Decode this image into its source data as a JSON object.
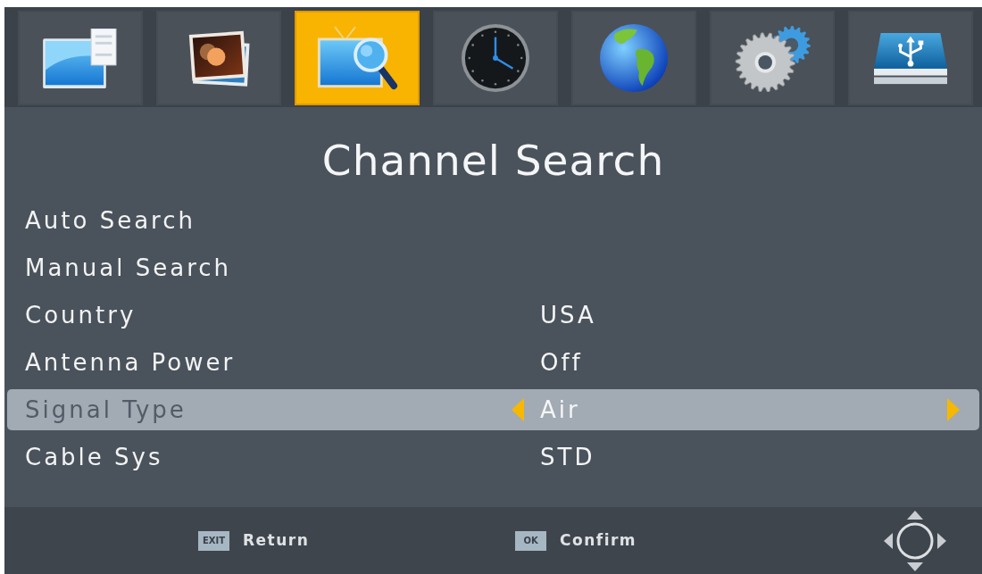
{
  "tabs": [
    {
      "kind": "document",
      "selected": false
    },
    {
      "kind": "photo",
      "selected": false
    },
    {
      "kind": "tv-search",
      "selected": true
    },
    {
      "kind": "clock",
      "selected": false
    },
    {
      "kind": "globe",
      "selected": false
    },
    {
      "kind": "gears",
      "selected": false
    },
    {
      "kind": "usb",
      "selected": false
    }
  ],
  "title": "Channel Search",
  "menu": [
    {
      "label": "Auto Search",
      "selected": false
    },
    {
      "label": "Manual Search",
      "selected": false
    },
    {
      "label": "Country",
      "value": "USA",
      "selected": false
    },
    {
      "label": "Antenna Power",
      "value": "Off",
      "selected": false
    },
    {
      "label": "Signal Type",
      "value": "Air",
      "selected": true
    },
    {
      "label": "Cable Sys",
      "value": "STD",
      "selected": false
    }
  ],
  "footer": {
    "hints": [
      {
        "key": "EXIT",
        "label": "Return"
      },
      {
        "key": "OK",
        "label": "Confirm"
      }
    ]
  }
}
